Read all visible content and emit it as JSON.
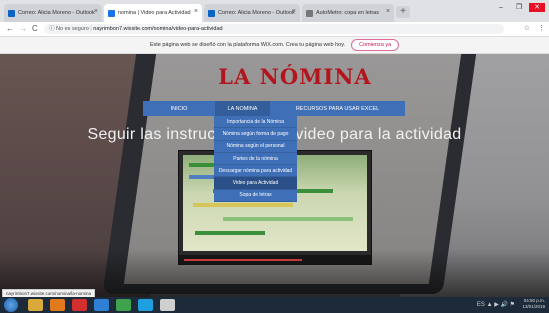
{
  "browser": {
    "tabs": [
      {
        "title": "Correo: Alicia Moreno - Outlook",
        "favicon_color": "#0a64c8",
        "active": false
      },
      {
        "title": "nomina | Video para Actividad",
        "favicon_color": "#1a73e8",
        "active": true
      },
      {
        "title": "Correo: Alicia Moreno - Outlook",
        "favicon_color": "#0a64c8",
        "active": false
      },
      {
        "title": "AutoMetro: copa en letras",
        "favicon_color": "#777777",
        "active": false
      }
    ],
    "tab_close_glyph": "×",
    "new_tab_glyph": "+",
    "window_controls": {
      "minimize": "–",
      "maximize": "❐",
      "close": "✕"
    },
    "nav": {
      "back": "←",
      "forward": "→",
      "reload": "C"
    },
    "security_label": "No es seguro",
    "url": "nayrimbon7.wixsite.com/nomina/video-para-actividad",
    "addr_icons": {
      "star": "☆",
      "menu": "⋮"
    }
  },
  "wix_banner": {
    "text": "Este página web se diseñó con la plataforma WiX.com. Crea tu página web hoy.",
    "button": "Comienza ya"
  },
  "site": {
    "title": "LA NÓMINA",
    "nav": [
      {
        "label": "INICIO"
      },
      {
        "label": "LA NOMINA"
      },
      {
        "label": "RECURSOS PARA USAR EXCEL"
      }
    ],
    "dropdown": [
      {
        "label": "Importancia de la Nómina",
        "selected": false
      },
      {
        "label": "Nómina según forma de pago",
        "selected": false
      },
      {
        "label": "Nómina según el personal",
        "selected": false
      },
      {
        "label": "Partes de la nómina",
        "selected": false
      },
      {
        "label": "Descargar nómina para actividad",
        "selected": false
      },
      {
        "label": "Video para Actividad",
        "selected": true
      },
      {
        "label": "Sopa de letras",
        "selected": false
      }
    ],
    "heading": "Seguir las instrucciones del video para la actividad",
    "video": {
      "progress": 0.65
    }
  },
  "status_url": "nayrimbon7.wixsite.com/nomina/la-nomina",
  "taskbar": {
    "apps": [
      {
        "name": "explorer-icon",
        "color": "#d9a93a"
      },
      {
        "name": "media-player-icon",
        "color": "#e07a1c"
      },
      {
        "name": "acrobat-icon",
        "color": "#d32f2f"
      },
      {
        "name": "edge-icon",
        "color": "#2f7fd6"
      },
      {
        "name": "chrome-icon",
        "color": "#3fa34d"
      },
      {
        "name": "skype-icon",
        "color": "#1ea0e0"
      },
      {
        "name": "app-icon",
        "color": "#cfcfcf"
      }
    ],
    "tray_icons": "ES ▲ ▶ 🔊 ⚑",
    "time": "04:50 p.m.",
    "date": "13/01/2019"
  }
}
